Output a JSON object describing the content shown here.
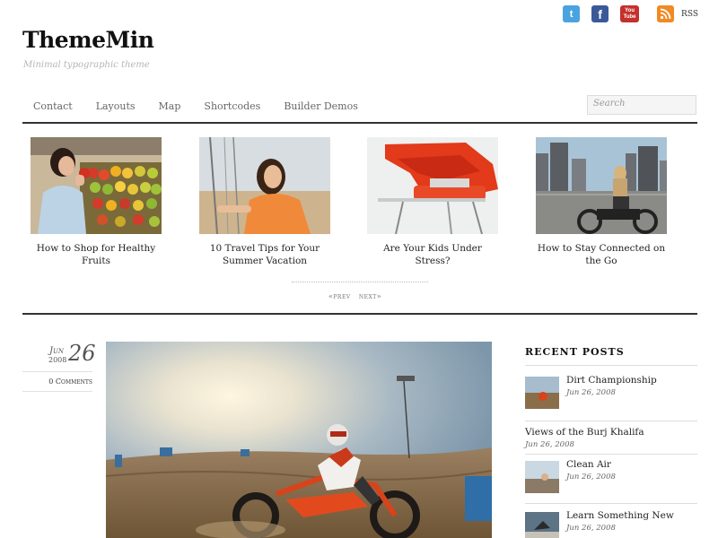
{
  "site": {
    "title": "ThemeMin",
    "tagline": "Minimal typographic theme"
  },
  "social": {
    "twitter_icon": "t",
    "facebook_icon": "f",
    "youtube_icon_top": "You",
    "youtube_icon_bottom": "Tube",
    "rss_label": "RSS"
  },
  "nav": {
    "items": [
      {
        "label": "Contact"
      },
      {
        "label": "Layouts"
      },
      {
        "label": "Map"
      },
      {
        "label": "Shortcodes"
      },
      {
        "label": "Builder Demos"
      }
    ],
    "search_placeholder": "Search"
  },
  "slider": {
    "items": [
      {
        "caption": "How to Shop for Healthy Fruits",
        "icon": "fruit-market-photo"
      },
      {
        "caption": "10 Travel Tips for Your Summer Vacation",
        "icon": "woman-swing-photo"
      },
      {
        "caption": "Are Your Kids Under Stress?",
        "icon": "red-chair-photo"
      },
      {
        "caption": "How to Stay Connected on the Go",
        "icon": "motorcycle-city-photo"
      }
    ],
    "prev_label": "«prev",
    "next_label": "next»"
  },
  "post": {
    "month": "Jun",
    "day": "26",
    "year": "2008",
    "comments": "0 Comments"
  },
  "sidebar": {
    "title": "RECENT POSTS",
    "posts": [
      {
        "title": "Dirt Championship",
        "date": "Jun 26, 2008",
        "has_thumb": true
      },
      {
        "title": "Views of the Burj Khalifa",
        "date": "Jun 26, 2008",
        "has_thumb": false
      },
      {
        "title": "Clean Air",
        "date": "Jun 26, 2008",
        "has_thumb": true
      },
      {
        "title": "Learn Something New",
        "date": "Jun 26, 2008",
        "has_thumb": true
      }
    ]
  }
}
